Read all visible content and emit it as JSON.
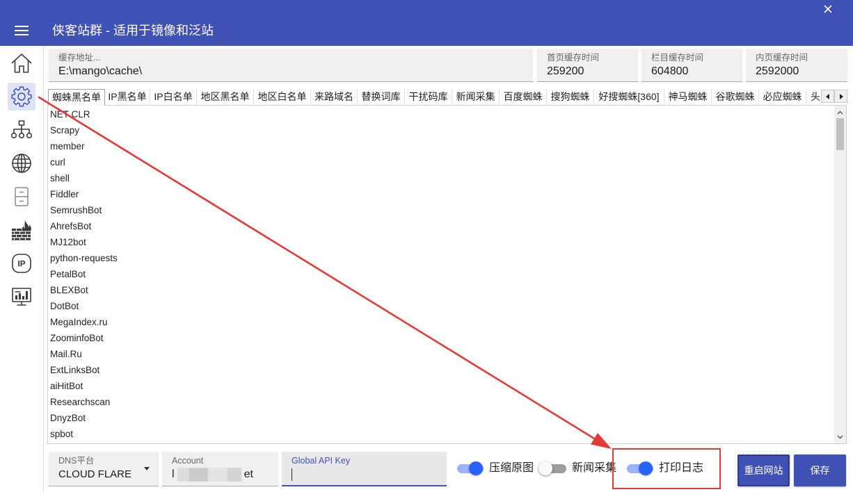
{
  "app": {
    "title": "侠客站群 - 适用于镜像和泛站",
    "menu_icon": "hamburger-menu-icon",
    "close_icon": "close-icon"
  },
  "colors": {
    "primary": "#3f51b5",
    "toggle_on": "#2962ff",
    "toggle_on_track": "#9db2ff",
    "annotation": "#e53935"
  },
  "sidebar": {
    "items": [
      {
        "icon": "home-icon",
        "selected": false
      },
      {
        "icon": "gear-icon",
        "selected": true
      },
      {
        "icon": "sitemap-icon",
        "selected": false
      },
      {
        "icon": "globe-icon",
        "selected": false
      },
      {
        "icon": "cabinet-icon",
        "selected": false
      },
      {
        "icon": "firewall-icon",
        "selected": false
      },
      {
        "icon": "ip-icon",
        "selected": false
      },
      {
        "icon": "monitor-chart-icon",
        "selected": false
      }
    ],
    "ip_icon_text": "IP"
  },
  "cache": {
    "path": {
      "label": "缓存地址...",
      "value": "E:\\mango\\cache\\"
    },
    "home_time": {
      "label": "首页缓存时间",
      "value": "259200"
    },
    "column_time": {
      "label": "栏目缓存时间",
      "value": "604800"
    },
    "inner_time": {
      "label": "内页缓存时间",
      "value": "2592000"
    }
  },
  "tabs": [
    "蜘蛛黑名单",
    "IP黑名单",
    "IP白名单",
    "地区黑名单",
    "地区白名单",
    "来路域名",
    "替换词库",
    "干扰码库",
    "新闻采集",
    "百度蜘蛛",
    "搜狗蜘蛛",
    "好搜蜘蛛[360]",
    "神马蜘蛛",
    "谷歌蜘蛛",
    "必应蜘蛛",
    "头"
  ],
  "active_tab": {
    "is_first": true
  },
  "list_items": [
    "NET CLR",
    "Scrapy",
    "member",
    "curl",
    "shell",
    "Fiddler",
    "SemrushBot",
    "AhrefsBot",
    "MJ12bot",
    "python-requests",
    "PetalBot",
    "BLEXBot",
    "DotBot",
    "MegaIndex.ru",
    "ZoominfoBot",
    "Mail.Ru",
    "ExtLinksBot",
    "aiHitBot",
    "Researchscan",
    "DnyzBot",
    "spbot"
  ],
  "bottom": {
    "dns": {
      "label": "DNS平台",
      "value": "CLOUD FLARE"
    },
    "account": {
      "label": "Account",
      "value_start": "l",
      "value_end": "et"
    },
    "api_key": {
      "label": "Global API Key",
      "value": ""
    },
    "toggles": [
      {
        "label": "压缩原图",
        "on": true
      },
      {
        "label": "新闻采集",
        "on": false
      },
      {
        "label": "打印日志",
        "on": true
      }
    ],
    "restart_button": "重启网站",
    "save_button": "保存"
  }
}
